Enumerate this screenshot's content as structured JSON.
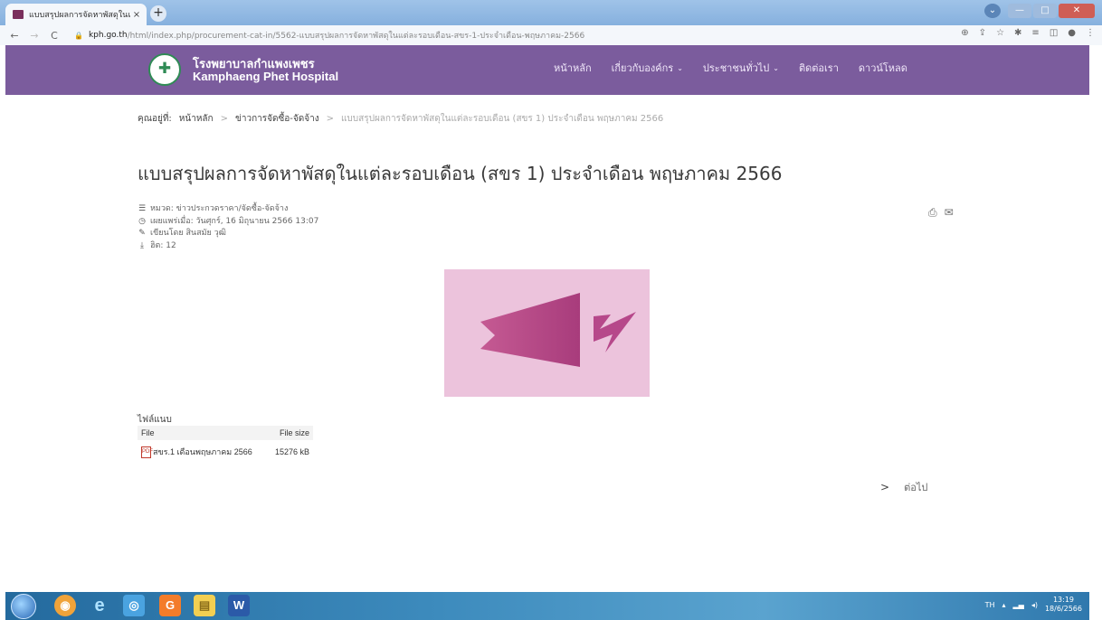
{
  "browser": {
    "tab_title": "แบบสรุปผลการจัดหาพัสดุในแต่ละรอบเ...",
    "tab_close": "×",
    "new_tab": "+",
    "nav_back": "←",
    "nav_forward": "→",
    "nav_reload": "C",
    "url_domain": "kph.go.th",
    "url_path": "/html/index.php/procurement-cat-in/5562-แบบสรุปผลการจัดหาพัสดุในแต่ละรอบเดือน-สขร-1-ประจำเดือน-พฤษภาคม-2566",
    "window_min": "—",
    "window_max": "□",
    "window_close": "✕"
  },
  "header": {
    "name_th": "โรงพยาบาลกำแพงเพชร",
    "name_en": "Kamphaeng Phet Hospital",
    "menu": [
      {
        "label": "หน้าหลัก",
        "has_dropdown": false
      },
      {
        "label": "เกี่ยวกับองค์กร",
        "has_dropdown": true
      },
      {
        "label": "ประชาชนทั่วไป",
        "has_dropdown": true
      },
      {
        "label": "ติดต่อเรา",
        "has_dropdown": false
      },
      {
        "label": "ดาวน์โหลด",
        "has_dropdown": false
      }
    ],
    "background_color": "#7b5c9d"
  },
  "breadcrumb": {
    "prefix": "คุณอยู่ที่:",
    "items": [
      "หน้าหลัก",
      "ข่าวการจัดซื้อ-จัดจ้าง"
    ],
    "current": "แบบสรุปผลการจัดหาพัสดุในแต่ละรอบเดือน (สขร 1) ประจำเดือน พฤษภาคม 2566",
    "separator": ">"
  },
  "article": {
    "title": "แบบสรุปผลการจัดหาพัสดุในแต่ละรอบเดือน (สขร 1) ประจำเดือน พฤษภาคม 2566",
    "category": "หมวด: ข่าวประกวดราคา/จัดซื้อ-จัดจ้าง",
    "published": "เผยแพร่เมื่อ: วันศุกร์, 16 มิถุนายน 2566 13:07",
    "author": "เขียนโดย สินสมัย วุฒิ",
    "hits": "ฮิต: 12",
    "image_color": "#ecc3dc"
  },
  "attachments": {
    "label": "ไฟล์แนบ",
    "columns": [
      "File",
      "File size"
    ],
    "rows": [
      {
        "file": "สขร.1 เดือนพฤษภาคม 2566",
        "size": "15276 kB"
      }
    ]
  },
  "pager": {
    "next_label": "ต่อไป",
    "arrow": ">"
  },
  "taskbar": {
    "language": "TH",
    "time": "13:19",
    "date": "18/6/2566"
  }
}
